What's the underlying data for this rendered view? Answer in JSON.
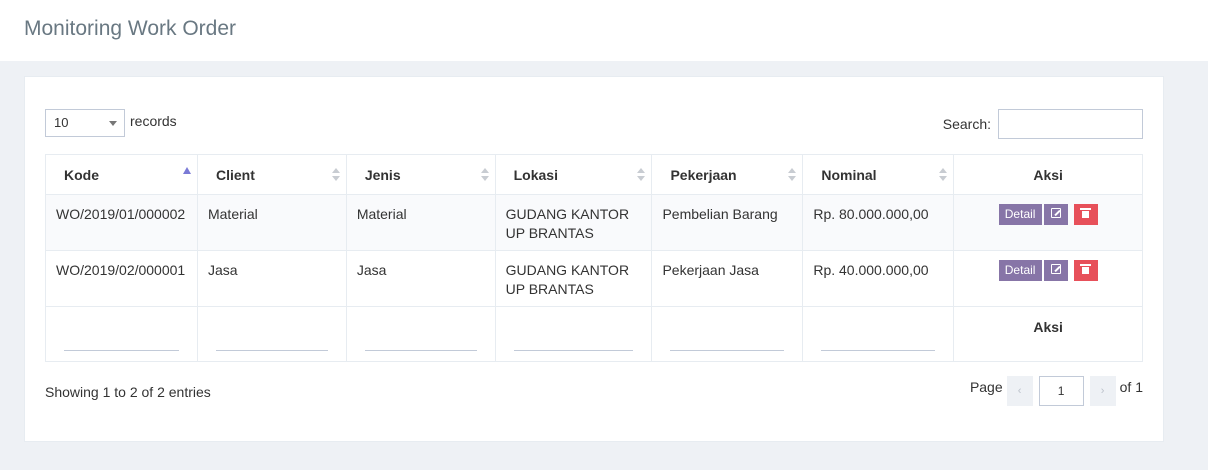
{
  "page": {
    "title": "Monitoring Work Order"
  },
  "length": {
    "value": "10",
    "label": "records"
  },
  "search": {
    "label": "Search:",
    "value": ""
  },
  "table": {
    "columns": [
      "Kode",
      "Client",
      "Jenis",
      "Lokasi",
      "Pekerjaan",
      "Nominal",
      "Aksi"
    ],
    "rows": [
      {
        "kode": "WO/2019/01/000002",
        "client": "Material",
        "jenis": "Material",
        "lokasi": "GUDANG KANTOR UP BRANTAS",
        "pekerjaan": "Pembelian Barang",
        "nominal": "Rp. 80.000.000,00"
      },
      {
        "kode": "WO/2019/02/000001",
        "client": "Jasa",
        "jenis": "Jasa",
        "lokasi": "GUDANG KANTOR UP BRANTAS",
        "pekerjaan": "Pekerjaan Jasa",
        "nominal": "Rp. 40.000.000,00"
      }
    ],
    "detail_label": "Detail",
    "footer_aksi": "Aksi"
  },
  "info": "Showing 1 to 2 of 2 entries",
  "pagination": {
    "label": "Page",
    "prev": "‹",
    "current": "1",
    "next": "›",
    "of": "of 1"
  },
  "colors": {
    "accent": "#8775a7",
    "danger": "#e7505a",
    "sort_active": "#7a7ad6"
  }
}
